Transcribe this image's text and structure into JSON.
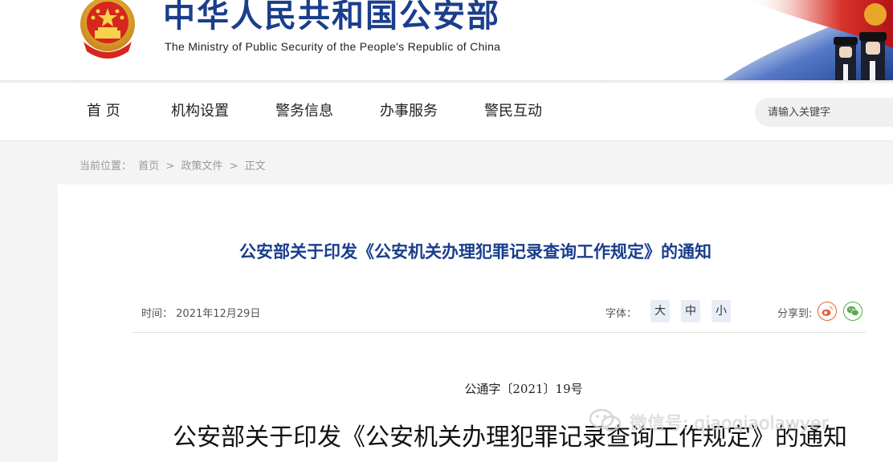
{
  "header": {
    "title_cn": "中华人民共和国公安部",
    "title_en": "The Ministry of Public Security of the People's Republic of China",
    "emblem_icon": "national-emblem-icon",
    "brand_color": "#1a3e8c"
  },
  "nav": {
    "items": [
      {
        "label": "首  页"
      },
      {
        "label": "机构设置"
      },
      {
        "label": "警务信息"
      },
      {
        "label": "办事服务"
      },
      {
        "label": "警民互动"
      }
    ],
    "search_placeholder": "请输入关键字"
  },
  "breadcrumb": {
    "prefix": "当前位置：",
    "items": [
      "首页",
      ">",
      "政策文件",
      ">",
      "正文"
    ]
  },
  "article": {
    "title": "公安部关于印发《公安机关办理犯罪记录查询工作规定》的通知",
    "time_label": "时间：",
    "time_value": "2021年12月29日",
    "font_label": "字体：",
    "font_sizes": [
      "大",
      "中",
      "小"
    ],
    "share_label": "分享到:",
    "share_icons": [
      "weibo-icon",
      "wechat-icon"
    ],
    "doc_number": "公通字〔2021〕19号",
    "doc_title": "公安部关于印发《公安机关办理犯罪记录查询工作规定》的通知"
  },
  "watermark": {
    "text": "微信号: qiaoqiaolawyer",
    "icon": "wechat-watermark-icon"
  }
}
